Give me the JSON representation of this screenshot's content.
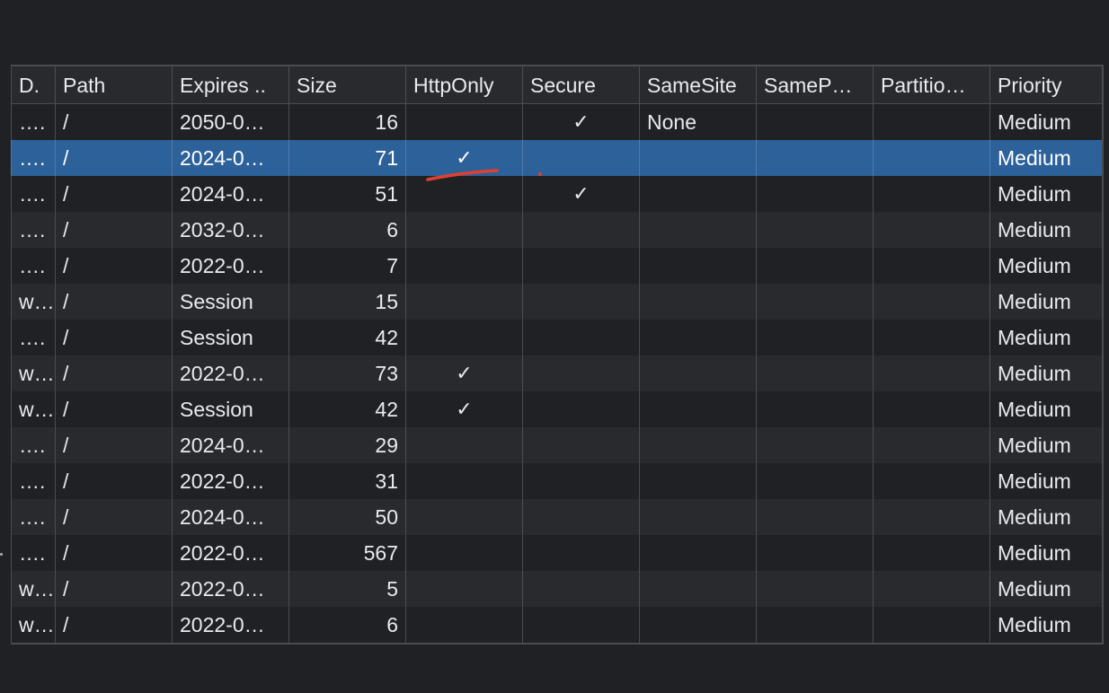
{
  "table": {
    "headers": [
      "D.",
      "Path",
      "Expires ..",
      "Size",
      "HttpOnly",
      "Secure",
      "SameSite",
      "SameP…",
      "Partitio…",
      "Priority"
    ],
    "check_glyph": "✓",
    "rows": [
      {
        "domain": "….",
        "path": "/",
        "expires": "2050-0…",
        "size": "16",
        "httponly": "",
        "secure": "✓",
        "samesite": "None",
        "samep": "",
        "partition": "",
        "priority": "Medium"
      },
      {
        "domain": "….",
        "path": "/",
        "expires": "2024-0…",
        "size": "71",
        "httponly": "✓",
        "secure": "",
        "samesite": "",
        "samep": "",
        "partition": "",
        "priority": "Medium",
        "selected": true
      },
      {
        "domain": "….",
        "path": "/",
        "expires": "2024-0…",
        "size": "51",
        "httponly": "",
        "secure": "✓",
        "samesite": "",
        "samep": "",
        "partition": "",
        "priority": "Medium"
      },
      {
        "domain": "….",
        "path": "/",
        "expires": "2032-0…",
        "size": "6",
        "httponly": "",
        "secure": "",
        "samesite": "",
        "samep": "",
        "partition": "",
        "priority": "Medium"
      },
      {
        "domain": "….",
        "path": "/",
        "expires": "2022-0…",
        "size": "7",
        "httponly": "",
        "secure": "",
        "samesite": "",
        "samep": "",
        "partition": "",
        "priority": "Medium"
      },
      {
        "domain": "w…",
        "path": "/",
        "expires": "Session",
        "size": "15",
        "httponly": "",
        "secure": "",
        "samesite": "",
        "samep": "",
        "partition": "",
        "priority": "Medium"
      },
      {
        "domain": "….",
        "path": "/",
        "expires": "Session",
        "size": "42",
        "httponly": "",
        "secure": "",
        "samesite": "",
        "samep": "",
        "partition": "",
        "priority": "Medium"
      },
      {
        "domain": "w…",
        "path": "/",
        "expires": "2022-0…",
        "size": "73",
        "httponly": "✓",
        "secure": "",
        "samesite": "",
        "samep": "",
        "partition": "",
        "priority": "Medium"
      },
      {
        "domain": "w…",
        "path": "/",
        "expires": "Session",
        "size": "42",
        "httponly": "✓",
        "secure": "",
        "samesite": "",
        "samep": "",
        "partition": "",
        "priority": "Medium"
      },
      {
        "domain": "….",
        "path": "/",
        "expires": "2024-0…",
        "size": "29",
        "httponly": "",
        "secure": "",
        "samesite": "",
        "samep": "",
        "partition": "",
        "priority": "Medium"
      },
      {
        "domain": "….",
        "path": "/",
        "expires": "2022-0…",
        "size": "31",
        "httponly": "",
        "secure": "",
        "samesite": "",
        "samep": "",
        "partition": "",
        "priority": "Medium"
      },
      {
        "domain": "….",
        "path": "/",
        "expires": "2024-0…",
        "size": "50",
        "httponly": "",
        "secure": "",
        "samesite": "",
        "samep": "",
        "partition": "",
        "priority": "Medium"
      },
      {
        "domain": "….",
        "path": "/",
        "expires": "2022-0…",
        "size": "567",
        "httponly": "",
        "secure": "",
        "samesite": "",
        "samep": "",
        "partition": "",
        "priority": "Medium"
      },
      {
        "domain": "w…",
        "path": "/",
        "expires": "2022-0…",
        "size": "5",
        "httponly": "",
        "secure": "",
        "samesite": "",
        "samep": "",
        "partition": "",
        "priority": "Medium"
      },
      {
        "domain": "w…",
        "path": "/",
        "expires": "2022-0…",
        "size": "6",
        "httponly": "",
        "secure": "",
        "samesite": "",
        "samep": "",
        "partition": "",
        "priority": "Medium"
      }
    ]
  },
  "colors": {
    "background": "#202124",
    "row_alt": "#292a2d",
    "selected_row": "#2d6199",
    "grid_line": "#4a4c50",
    "text": "#e8eaed",
    "annotation": "#e0402f"
  }
}
